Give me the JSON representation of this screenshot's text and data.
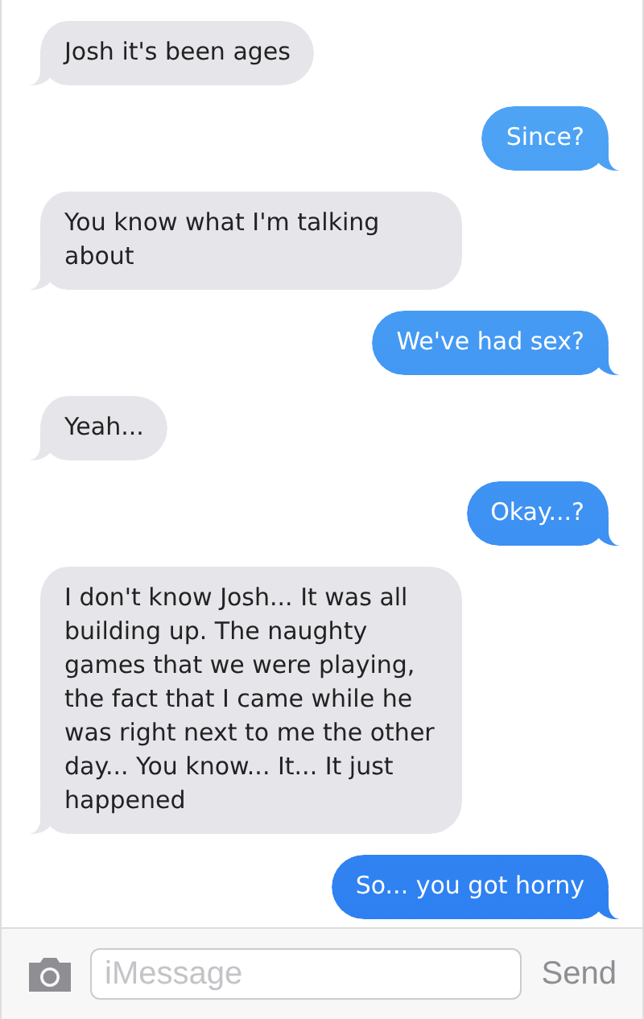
{
  "messages": [
    {
      "kind": "incoming",
      "text": "Josh it's been ages"
    },
    {
      "kind": "outgoing",
      "text": "Since?"
    },
    {
      "kind": "incoming",
      "text": "You know what I'm talking about"
    },
    {
      "kind": "outgoing",
      "text": "We've had sex?"
    },
    {
      "kind": "incoming",
      "text": "Yeah..."
    },
    {
      "kind": "outgoing",
      "text": "Okay...?"
    },
    {
      "kind": "incoming",
      "text": "I don't know Josh... It was all building up. The naughty games that we were playing, the fact that I came while he was right next to me the other day... You know... It... It just happened"
    },
    {
      "kind": "outgoing",
      "text": "So... you got horny"
    }
  ],
  "composer": {
    "placeholder": "iMessage",
    "send": "Send"
  }
}
